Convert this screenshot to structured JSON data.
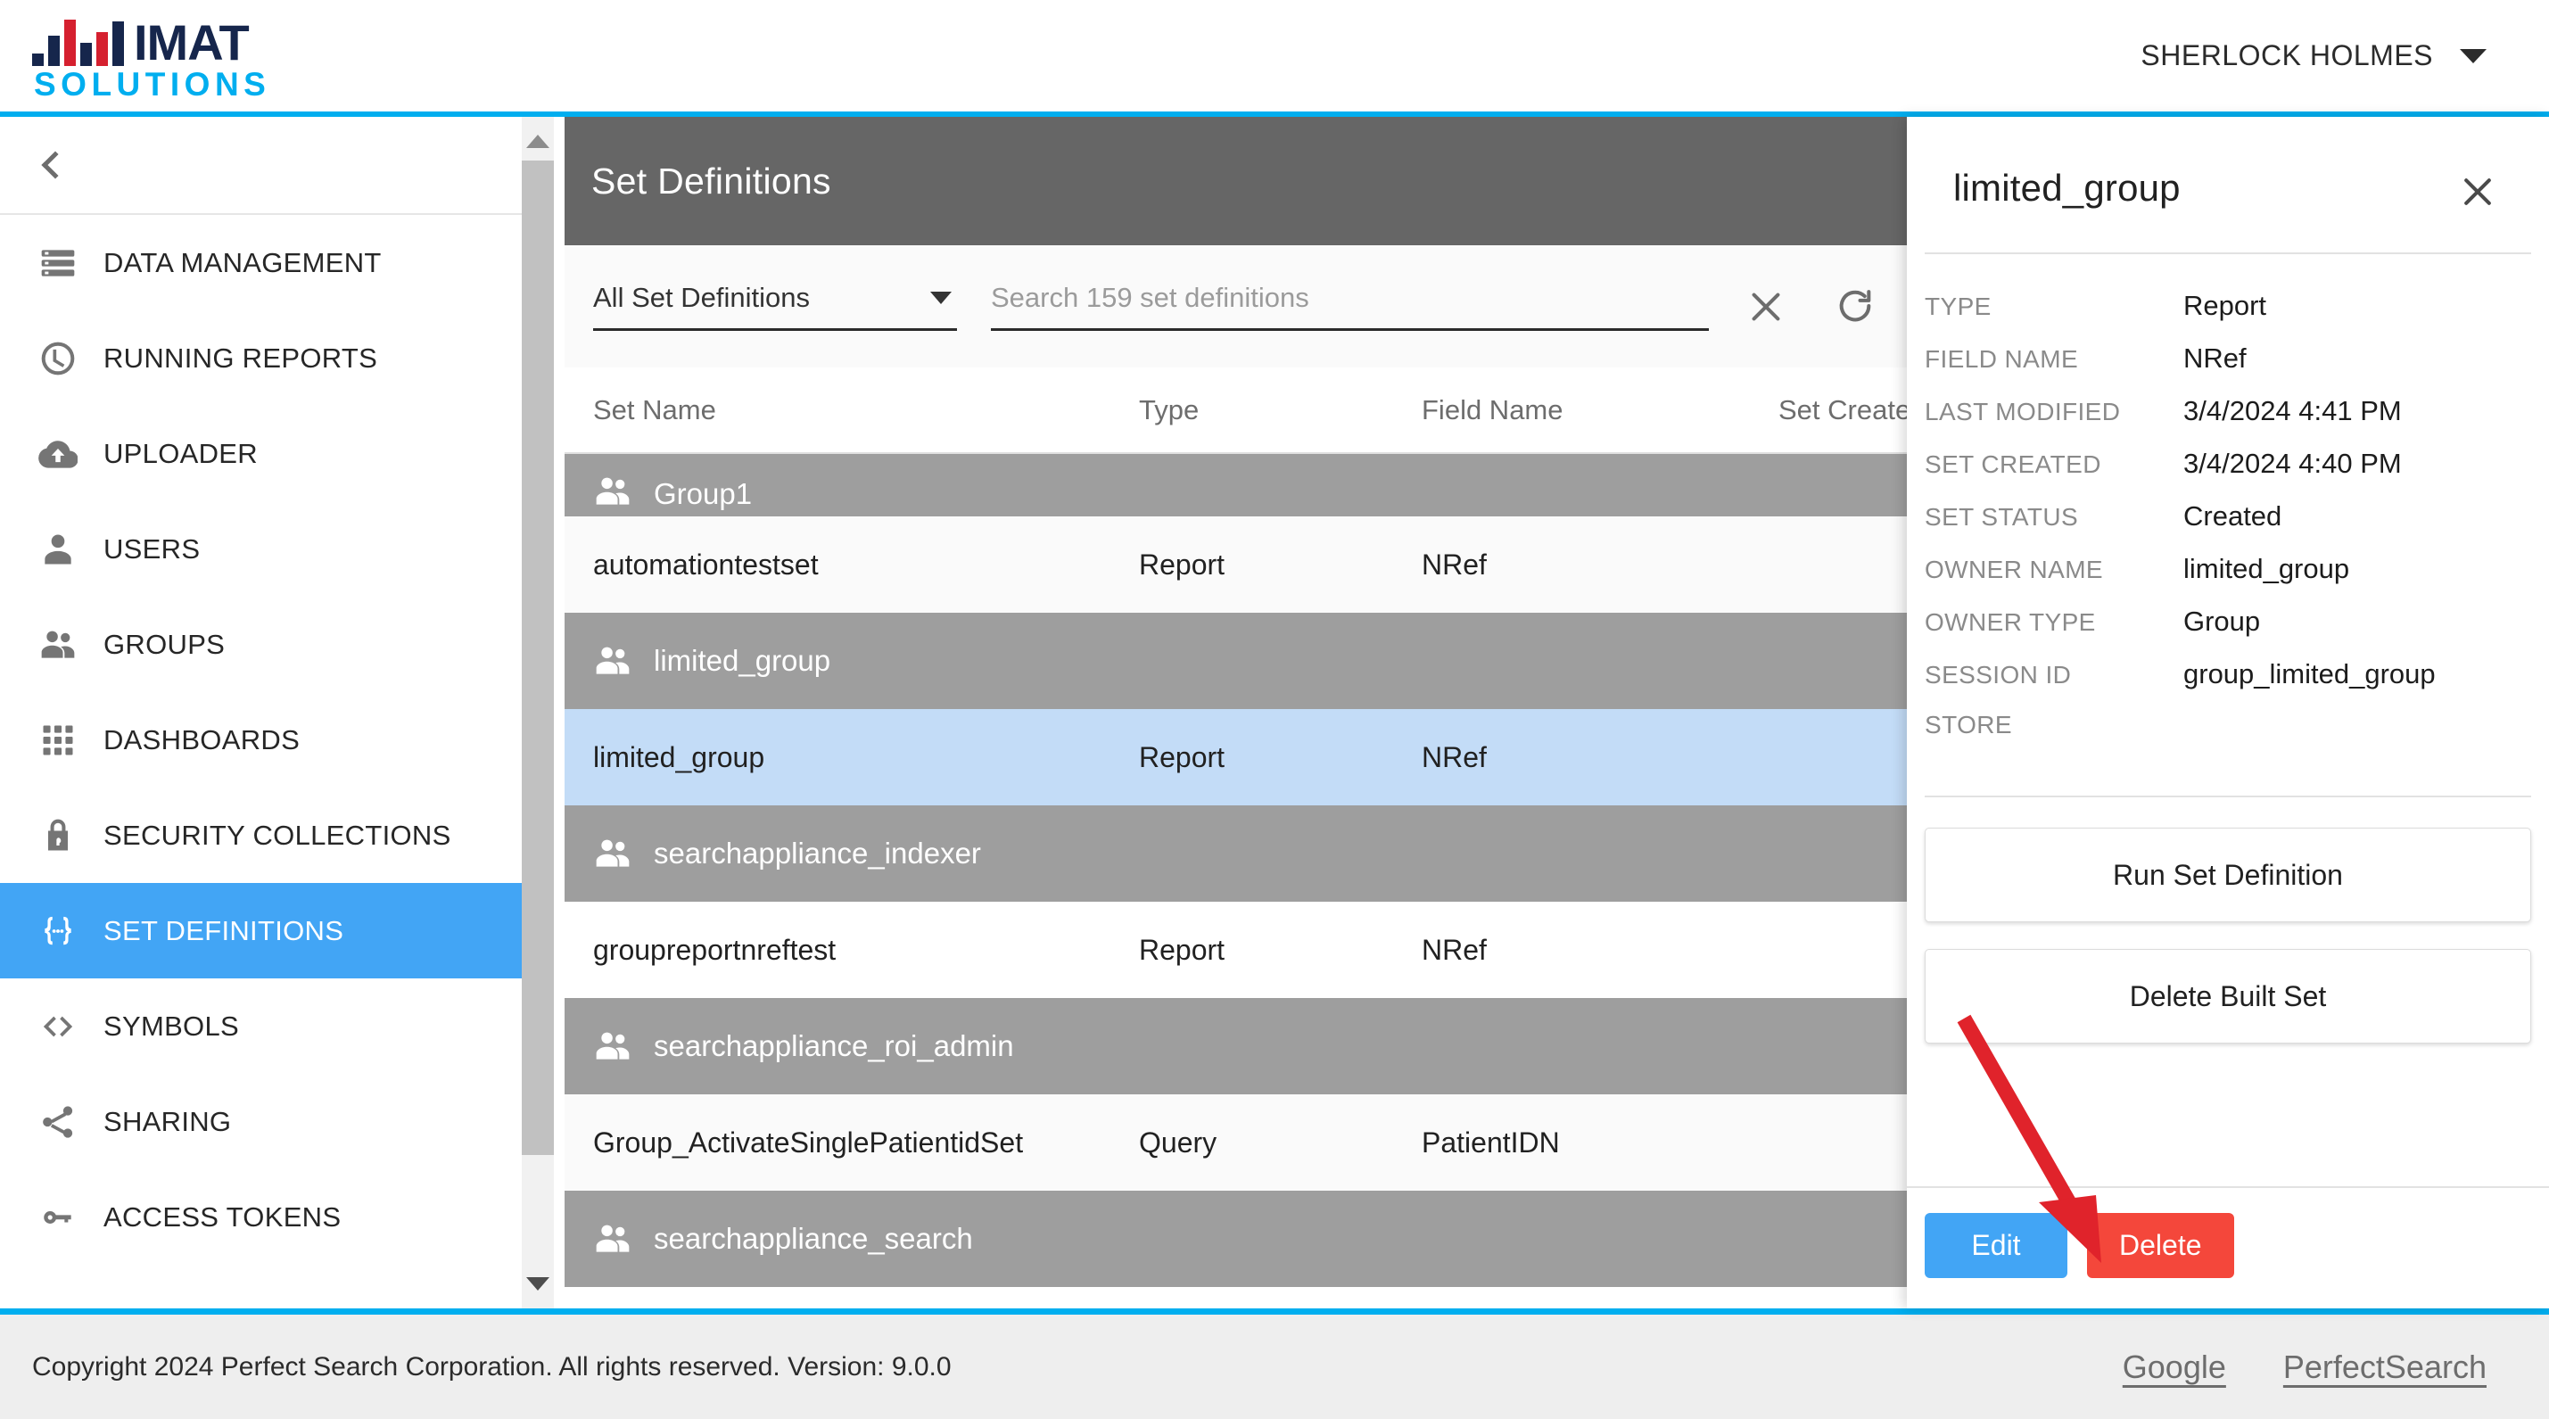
{
  "brand": {
    "name_primary": "IMAT",
    "name_secondary": "SOLUTIONS",
    "navy": "#16264C",
    "red": "#D5202F",
    "cyan": "#00AEEF"
  },
  "topbar": {
    "user_name": "SHERLOCK HOLMES",
    "caret_icon": "chevron-down-icon"
  },
  "sidebar": {
    "collapse_icon": "chevron-left-icon",
    "items": [
      {
        "label": "DATA MANAGEMENT",
        "icon": "storage-icon",
        "active": false
      },
      {
        "label": "RUNNING REPORTS",
        "icon": "clock-icon",
        "active": false
      },
      {
        "label": "UPLOADER",
        "icon": "cloud-upload-icon",
        "active": false
      },
      {
        "label": "USERS",
        "icon": "person-icon",
        "active": false
      },
      {
        "label": "GROUPS",
        "icon": "people-icon",
        "active": false
      },
      {
        "label": "DASHBOARDS",
        "icon": "grid-apps-icon",
        "active": false
      },
      {
        "label": "SECURITY COLLECTIONS",
        "icon": "lock-icon",
        "active": false
      },
      {
        "label": "SET DEFINITIONS",
        "icon": "braces-icon",
        "active": true
      },
      {
        "label": "SYMBOLS",
        "icon": "code-brackets-icon",
        "active": false
      },
      {
        "label": "SHARING",
        "icon": "share-icon",
        "active": false
      },
      {
        "label": "ACCESS TOKENS",
        "icon": "key-icon",
        "active": false
      }
    ],
    "active_color": "#42A5F5"
  },
  "page": {
    "title": "Set Definitions",
    "help_icon": "help-circle-icon",
    "header_bg": "#666666"
  },
  "toolbar": {
    "filter_value": "All Set Definitions",
    "filter_caret_icon": "caret-down-icon",
    "search_value": "",
    "search_placeholder": "Search 159 set definitions",
    "clear_icon": "close-x-icon",
    "refresh_icon": "refresh-icon"
  },
  "table": {
    "columns": [
      "Set Name",
      "Type",
      "Field Name",
      "Set Created"
    ],
    "rows": [
      {
        "kind": "group",
        "name": "Group1",
        "clipped": true
      },
      {
        "kind": "data",
        "name": "automationtestset",
        "type": "Report",
        "field": "NRef",
        "created": "",
        "selected": false
      },
      {
        "kind": "group",
        "name": "limited_group"
      },
      {
        "kind": "data",
        "name": "limited_group",
        "type": "Report",
        "field": "NRef",
        "created": "",
        "selected": true
      },
      {
        "kind": "group",
        "name": "searchappliance_indexer"
      },
      {
        "kind": "data",
        "name": "groupreportnreftest",
        "type": "Report",
        "field": "NRef",
        "created": "",
        "selected": false
      },
      {
        "kind": "group",
        "name": "searchappliance_roi_admin"
      },
      {
        "kind": "data",
        "name": "Group_ActivateSinglePatientidSet",
        "type": "Query",
        "field": "PatientIDN",
        "created": "",
        "selected": false
      },
      {
        "kind": "group",
        "name": "searchappliance_search"
      }
    ]
  },
  "detail": {
    "title": "limited_group",
    "close_icon": "close-x-icon",
    "fields": [
      {
        "key": "TYPE",
        "value": "Report"
      },
      {
        "key": "FIELD NAME",
        "value": "NRef"
      },
      {
        "key": "LAST MODIFIED",
        "value": "3/4/2024 4:41 PM"
      },
      {
        "key": "SET CREATED",
        "value": "3/4/2024 4:40 PM"
      },
      {
        "key": "SET STATUS",
        "value": "Created"
      },
      {
        "key": "OWNER NAME",
        "value": "limited_group"
      },
      {
        "key": "OWNER TYPE",
        "value": "Group"
      },
      {
        "key": "SESSION ID",
        "value": "group_limited_group"
      },
      {
        "key": "STORE",
        "value": ""
      }
    ],
    "actions": [
      {
        "label": "Run Set Definition"
      },
      {
        "label": "Delete Built Set"
      }
    ],
    "edit_label": "Edit",
    "delete_label": "Delete",
    "edit_color": "#42A5F5",
    "delete_color": "#F4473B"
  },
  "annotation": {
    "shape": "arrow",
    "color": "#E0232B",
    "points_to": "delete-button"
  },
  "footer": {
    "copyright": "Copyright 2024 Perfect Search Corporation. All rights reserved. Version: 9.0.0",
    "links": [
      "Google",
      "PerfectSearch"
    ]
  }
}
